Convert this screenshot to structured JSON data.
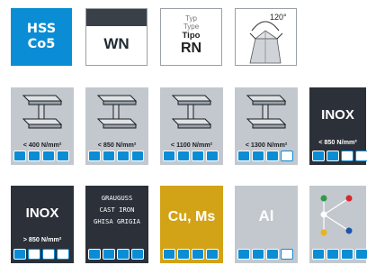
{
  "colors": {
    "accent": "#0A8DD4",
    "dark": "#2b3039",
    "gray": "#c3c8ce",
    "gold": "#d3a317"
  },
  "top": {
    "material": {
      "line1": "HSS",
      "line2": "Co5"
    },
    "standard": {
      "label": "WN"
    },
    "type": {
      "typ": "Typ",
      "type": "Type",
      "tipo": "Tipo",
      "code": "RN"
    },
    "angle": {
      "value": "120°"
    }
  },
  "tiles": [
    {
      "label": "< 400 N/mm²",
      "level": 4
    },
    {
      "label": "< 850 N/mm²",
      "level": 4
    },
    {
      "label": "< 1100 N/mm²",
      "level": 4
    },
    {
      "label": "< 1300 N/mm²",
      "level": 3
    },
    {
      "title": "INOX",
      "label": "< 850 N/mm²",
      "level": 2
    },
    {
      "title": "INOX",
      "label": "> 850 N/mm²",
      "level": 1
    },
    {
      "lines": [
        "GRAUGUSS",
        "CAST IRON",
        "GHISA GRIGIA"
      ],
      "level": 4
    },
    {
      "title": "Cu, Ms",
      "level": 4
    },
    {
      "title": "Al",
      "level": 3
    },
    {
      "icon": "network-icon",
      "level": 4
    }
  ]
}
